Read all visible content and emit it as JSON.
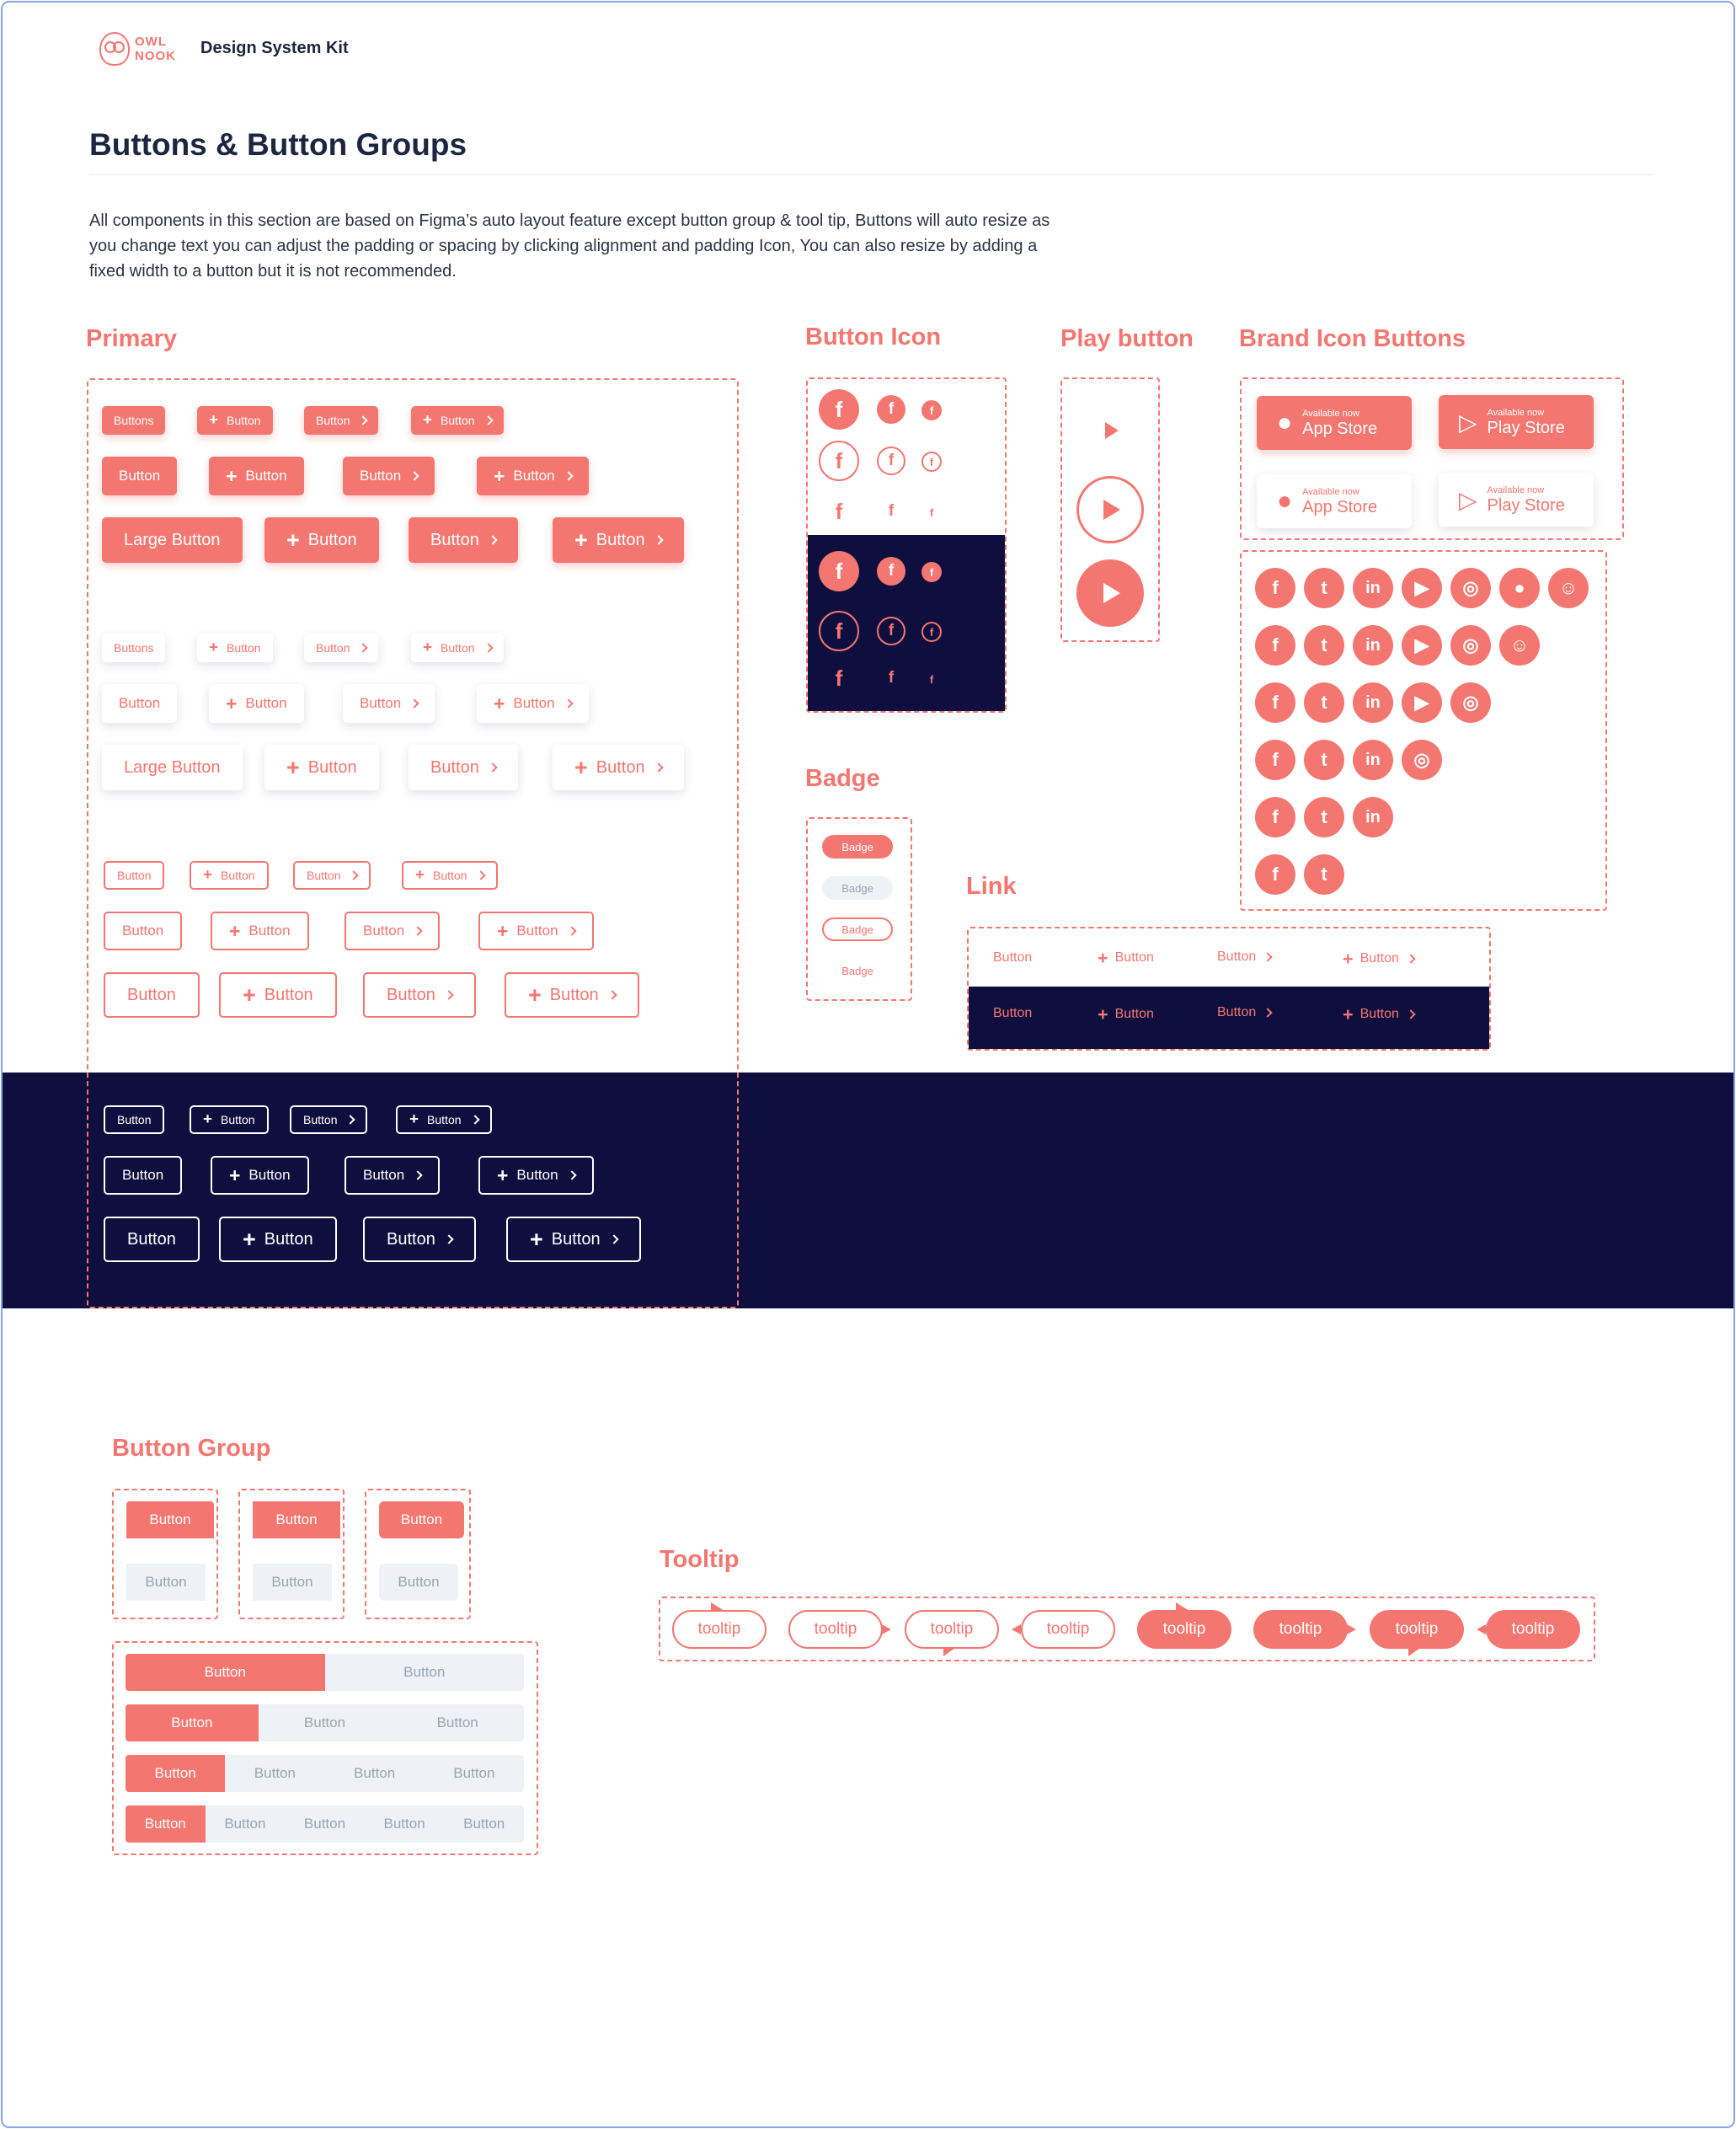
{
  "header": {
    "logo_line1": "OWL",
    "logo_line2": "NOOK",
    "title": "Design System Kit"
  },
  "page": {
    "heading": "Buttons & Button Groups",
    "description": "All components in this section are based on Figma’s auto layout feature except button group & tool tip, Buttons will auto resize as you change text you can adjust the padding or spacing by clicking alignment and padding Icon, You can also resize by adding a fixed width to a button but it is not recommended."
  },
  "sections": {
    "primary": "Primary",
    "button_icon": "Button Icon",
    "play_button": "Play button",
    "brand_icon_buttons": "Brand Icon Buttons",
    "badge": "Badge",
    "link": "Link",
    "button_group": "Button Group",
    "tooltip": "Tooltip"
  },
  "buttons": {
    "buttons": "Buttons",
    "button": "Button",
    "large": "Large Button"
  },
  "icons": {
    "facebook": "f",
    "twitter": "t",
    "linkedin": "in",
    "youtube": "▶",
    "instagram": "◎",
    "reddit": "●",
    "snapchat": "☺"
  },
  "stores": {
    "available": "Available now",
    "app_store": "App Store",
    "play_store": "Play Store"
  },
  "badges": {
    "label": "Badge"
  },
  "tooltip": {
    "label": "tooltip"
  },
  "colors": {
    "accent": "#f47670",
    "navy": "#0f0f3f",
    "light": "#eef2f7",
    "text": "#1b2640"
  }
}
